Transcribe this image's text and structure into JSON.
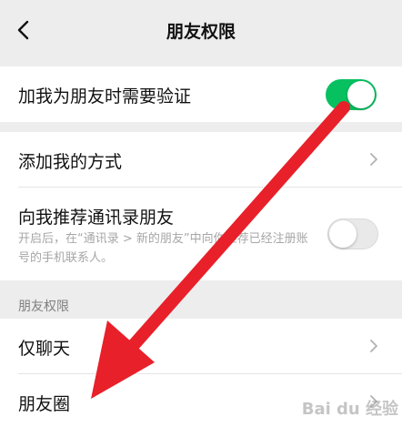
{
  "nav": {
    "title": "朋友权限"
  },
  "group1": {
    "verify_label": "加我为朋友时需要验证",
    "verify_enabled": true
  },
  "group2": {
    "add_method_label": "添加我的方式",
    "recommend_label": "向我推荐通讯录朋友",
    "recommend_description": "开启后，在“通讯录 > 新的朋友”中向你推荐已经注册账号的手机联系人。",
    "recommend_enabled": false
  },
  "section": {
    "header": "朋友权限"
  },
  "group3": {
    "chat_only_label": "仅聊天",
    "moments_label": "朋友圈"
  },
  "colors": {
    "toggle_on": "#07c160",
    "annotation_arrow": "#e8202a",
    "background": "#ededed"
  },
  "icons": [
    "back-arrow-icon",
    "chevron-right-icon",
    "toggle-switch",
    "annotation-arrow"
  ],
  "watermark": "Bai du 经验"
}
